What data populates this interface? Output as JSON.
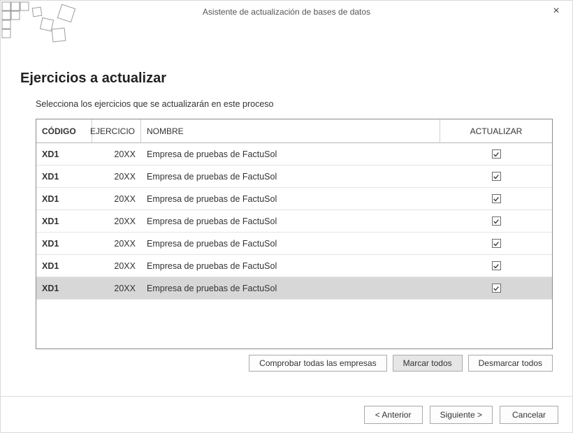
{
  "window": {
    "title": "Asistente de actualización de bases de datos"
  },
  "page": {
    "heading": "Ejercicios a actualizar",
    "subheading": "Selecciona los ejercicios que se actualizarán en este proceso"
  },
  "grid": {
    "headers": {
      "code": "CÓDIGO",
      "year": "EJERCICIO",
      "name": "NOMBRE",
      "update": "ACTUALIZAR"
    },
    "rows": [
      {
        "code": "XD1",
        "year": "20XX",
        "name": "Empresa de pruebas de FactuSol",
        "checked": true,
        "selected": false
      },
      {
        "code": "XD1",
        "year": "20XX",
        "name": "Empresa de pruebas de FactuSol",
        "checked": true,
        "selected": false
      },
      {
        "code": "XD1",
        "year": "20XX",
        "name": "Empresa de pruebas de FactuSol",
        "checked": true,
        "selected": false
      },
      {
        "code": "XD1",
        "year": "20XX",
        "name": "Empresa de pruebas de FactuSol",
        "checked": true,
        "selected": false
      },
      {
        "code": "XD1",
        "year": "20XX",
        "name": "Empresa de pruebas de FactuSol",
        "checked": true,
        "selected": false
      },
      {
        "code": "XD1",
        "year": "20XX",
        "name": "Empresa de pruebas de FactuSol",
        "checked": true,
        "selected": false
      },
      {
        "code": "XD1",
        "year": "20XX",
        "name": "Empresa de pruebas de FactuSol",
        "checked": true,
        "selected": true
      }
    ]
  },
  "toolbar": {
    "check_all_companies": "Comprobar todas las empresas",
    "mark_all": "Marcar todos",
    "unmark_all": "Desmarcar todos"
  },
  "footer": {
    "prev": "<  Anterior",
    "next": "Siguiente  >",
    "cancel": "Cancelar"
  },
  "icons": {
    "close": "×"
  }
}
